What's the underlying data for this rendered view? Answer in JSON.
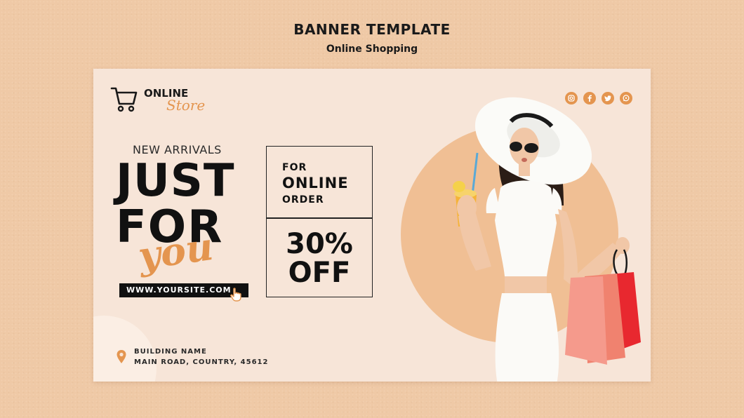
{
  "header": {
    "title": "BANNER TEMPLATE",
    "subtitle": "Online Shopping"
  },
  "banner": {
    "logo": {
      "line1": "ONLINE",
      "line2": "Store",
      "icon": "shopping-cart-icon"
    },
    "social_icons": [
      "instagram-icon",
      "facebook-icon",
      "twitter-icon",
      "whatsapp-icon"
    ],
    "new_arrivals": "NEW ARRIVALS",
    "headline_line1": "JUST",
    "headline_line2": "FOR",
    "script_word": "you",
    "website": "WWW.YOURSITE.COM",
    "promo": {
      "line1": "FOR",
      "line2": "ONLINE",
      "line3": "ORDER",
      "discount": "30%",
      "discount_word": "OFF"
    },
    "address": {
      "line1": "BUILDING NAME",
      "line2": "MAIN ROAD, COUNTRY, 45612"
    }
  },
  "colors": {
    "accent": "#e4954f",
    "background": "#efc9a6",
    "banner_bg": "#f7e5d8",
    "circle": "#f0bf94",
    "text": "#111111"
  }
}
